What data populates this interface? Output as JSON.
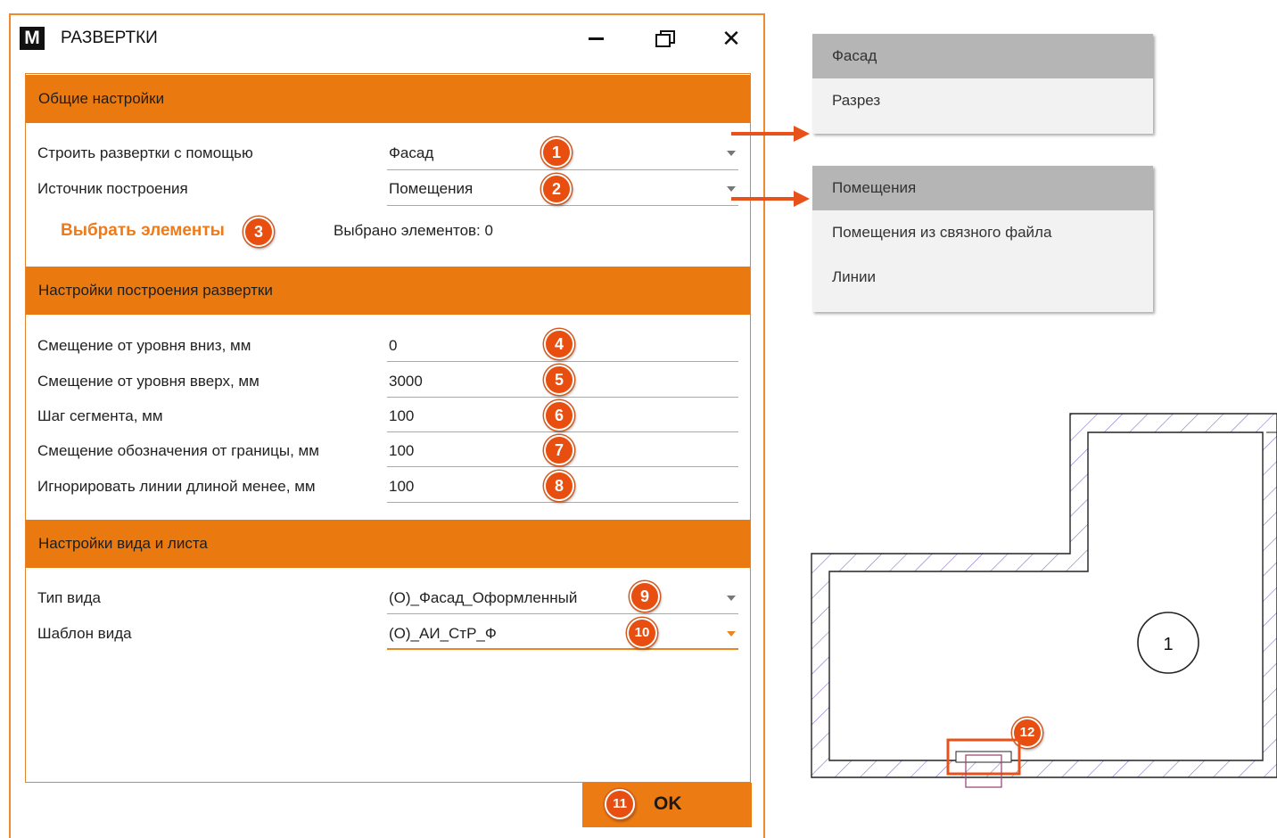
{
  "window": {
    "logo": "M",
    "title": "РАЗВЕРТКИ",
    "close_glyph": "✕"
  },
  "general": {
    "header": "Общие настройки",
    "build_with_label": "Строить развертки с помощью",
    "build_with_value": "Фасад",
    "source_label": "Источник построения",
    "source_value": "Помещения",
    "select_elements": "Выбрать элементы",
    "selected_count": "Выбрано элементов: 0"
  },
  "build": {
    "header": "Настройки построения развертки",
    "fields": [
      {
        "label": "Смещение от уровня вниз, мм",
        "value": "0"
      },
      {
        "label": "Смещение от уровня вверх, мм",
        "value": "3000"
      },
      {
        "label": "Шаг сегмента, мм",
        "value": "100"
      },
      {
        "label": "Смещение обозначения от границы, мм",
        "value": "100"
      },
      {
        "label": "Игнорировать линии длиной менее, мм",
        "value": "100"
      }
    ]
  },
  "view": {
    "header": "Настройки вида и листа",
    "type_label": "Тип вида",
    "type_value": "(О)_Фасад_Оформленный",
    "template_label": "Шаблон вида",
    "template_value": "(О)_АИ_СтР_Ф"
  },
  "ok_label": "OK",
  "badges": [
    "1",
    "2",
    "3",
    "4",
    "5",
    "6",
    "7",
    "8",
    "9",
    "10",
    "11",
    "12"
  ],
  "popup_build_with": {
    "options": [
      "Фасад",
      "Разрез"
    ],
    "selected": "Фасад"
  },
  "popup_source": {
    "options": [
      "Помещения",
      "Помещения из связного файла",
      "Линии"
    ],
    "selected": "Помещения"
  },
  "plan": {
    "room_tag": "1"
  },
  "colors": {
    "accent": "#ea7a10",
    "badge": "#e84e0f",
    "arrow": "#e8521a",
    "hatch": "#8a70c8"
  }
}
